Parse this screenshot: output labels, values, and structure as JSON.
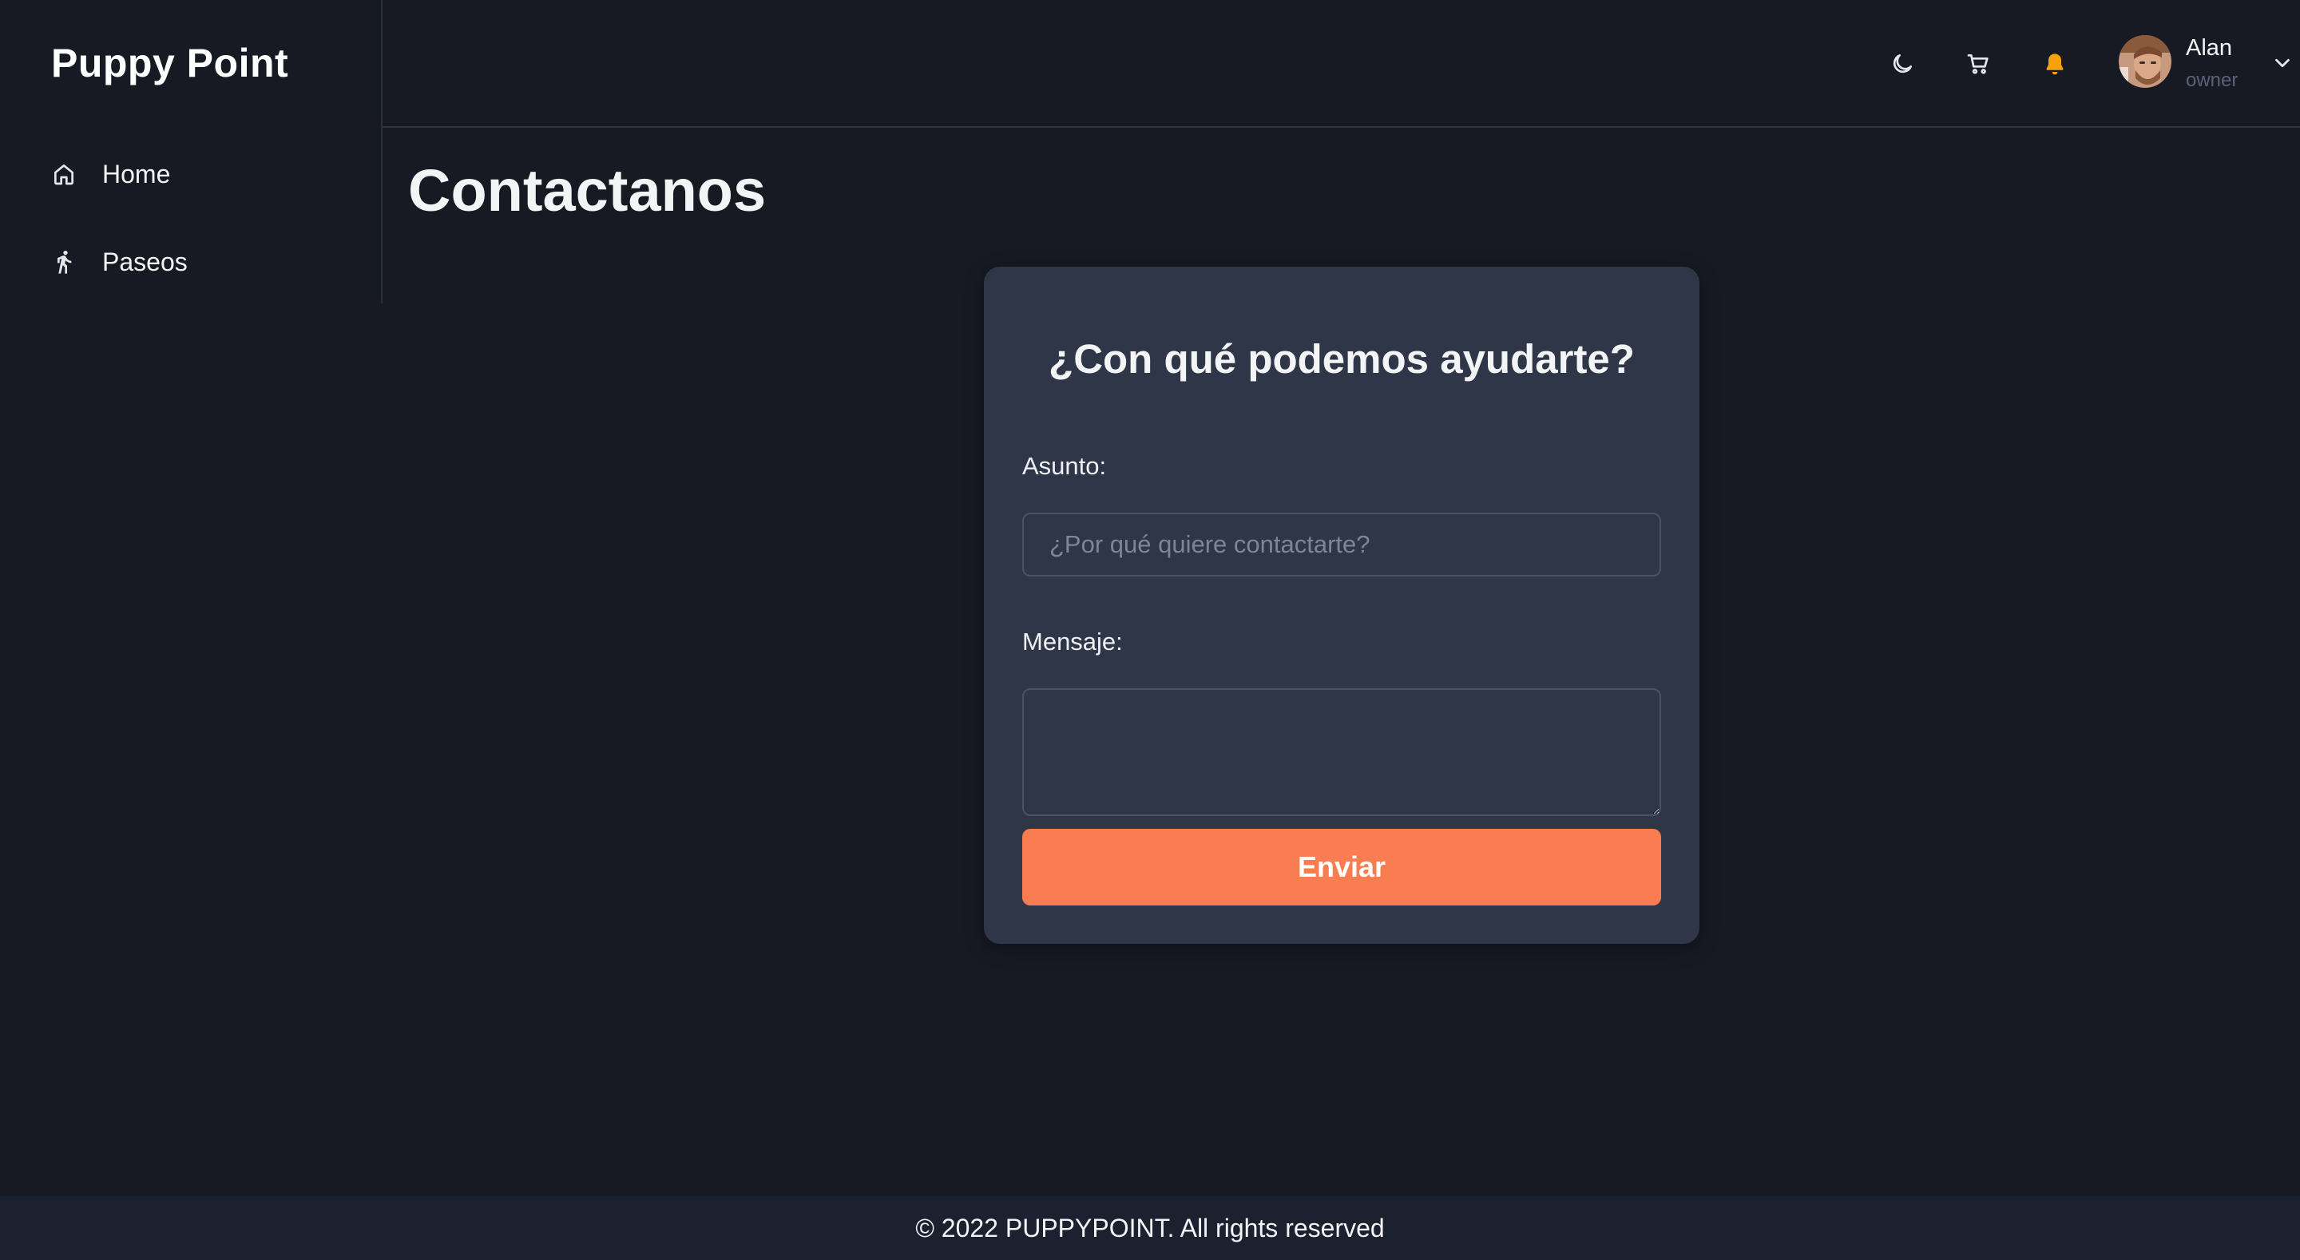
{
  "app": {
    "brand": "Puppy Point"
  },
  "sidebar": {
    "items": [
      {
        "label": "Home",
        "icon": "home-icon"
      },
      {
        "label": "Paseos",
        "icon": "walking-person-icon"
      }
    ]
  },
  "header": {
    "icons": [
      "moon-icon",
      "cart-icon",
      "bell-icon"
    ],
    "bell_color": "#f5a30b",
    "user": {
      "name": "Alan",
      "role": "owner"
    }
  },
  "main": {
    "title": "Contactanos",
    "form": {
      "heading": "¿Con qué podemos ayudarte?",
      "subject_label": "Asunto:",
      "subject_placeholder": "¿Por qué quiere contactarte?",
      "subject_value": "",
      "message_label": "Mensaje:",
      "message_value": "",
      "submit_label": "Enviar"
    }
  },
  "theme": {
    "accent": "#fa7c51",
    "background": "#171a23",
    "card": "#2e3648"
  },
  "footer": {
    "text": "© 2022 PUPPYPOINT. All rights reserved"
  }
}
